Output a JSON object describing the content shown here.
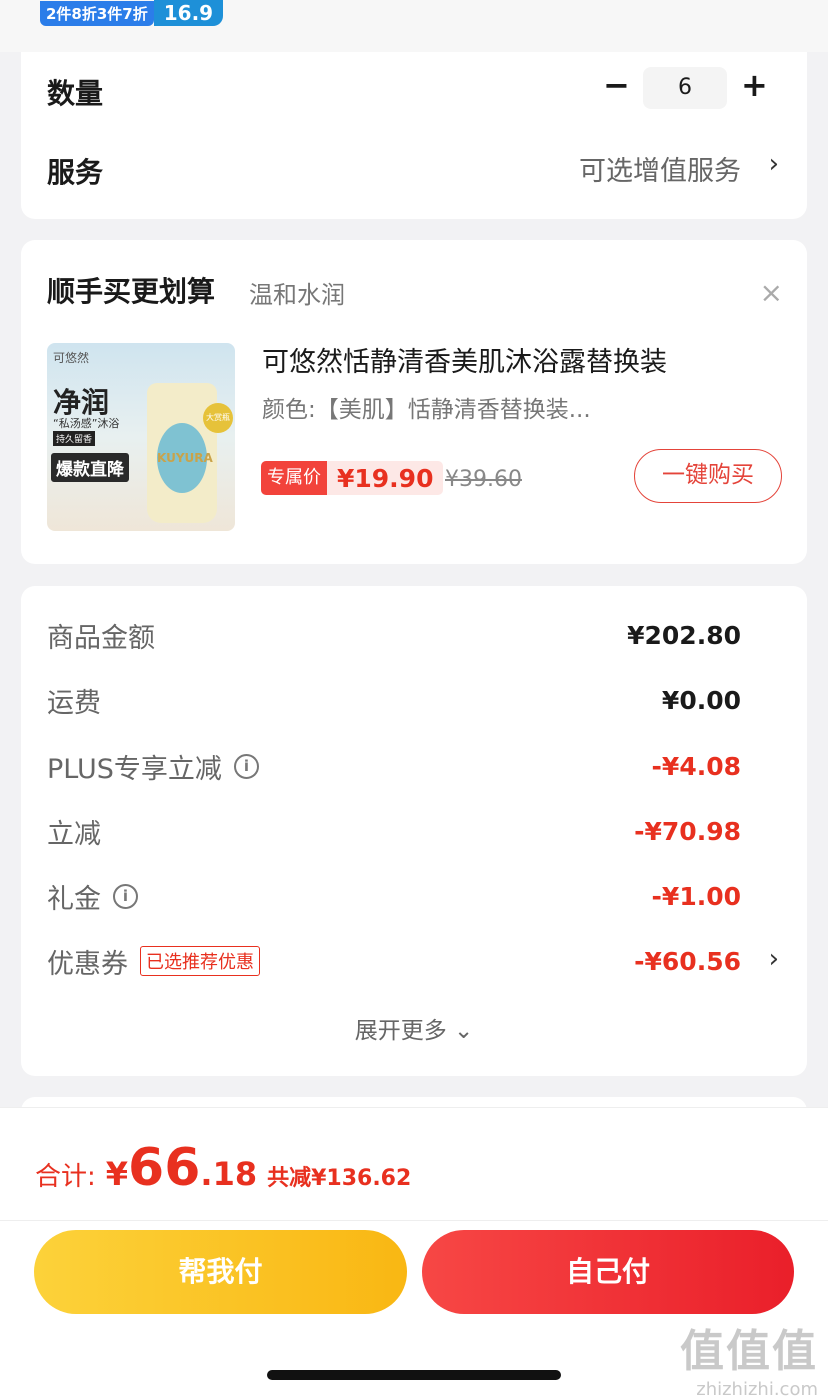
{
  "promo": {
    "text": "2件8折3件7折",
    "badge": "16.9"
  },
  "quantity": {
    "label": "数量",
    "minus": "−",
    "value": "6",
    "plus": "+"
  },
  "service": {
    "label": "服务",
    "value": "可选增值服务",
    "chevron": "›"
  },
  "recommend": {
    "title": "顺手买更划算",
    "subtitle": "温和水润",
    "close": "×",
    "product": {
      "image_brand": "可悠然",
      "image_headline": "净润",
      "image_sub": "“私汤感”沐浴",
      "image_tag": "持久留香",
      "image_hot": "爆款直降",
      "image_label": "KUYURA",
      "image_seal": "大赏瓶",
      "name": "可悠然恬静清香美肌沐浴露替换装",
      "spec": "颜色:【美肌】恬静清香替换装...",
      "price_label": "专属价",
      "price": "¥19.90",
      "original_price": "¥39.60",
      "buy_label": "一键购买"
    }
  },
  "summary": {
    "rows": [
      {
        "label": "商品金额",
        "value": "¥202.80",
        "red": false,
        "info": false
      },
      {
        "label": "运费",
        "value": "¥0.00",
        "red": false,
        "info": false
      },
      {
        "label": "PLUS专享立减",
        "value": "-¥4.08",
        "red": true,
        "info": true
      },
      {
        "label": "立减",
        "value": "-¥70.98",
        "red": true,
        "info": false
      },
      {
        "label": "礼金",
        "value": "-¥1.00",
        "red": true,
        "info": true
      },
      {
        "label": "优惠券",
        "value": "-¥60.56",
        "red": true,
        "info": false,
        "tag": "已选推荐优惠"
      }
    ],
    "info_glyph": "i",
    "chevron": "›",
    "expand_label": "展开更多 ⌄"
  },
  "total": {
    "label": "合计:",
    "currency": "¥",
    "integer": "66",
    "decimal": ".18",
    "saved": "共减¥136.62"
  },
  "actions": {
    "help_pay": "帮我付",
    "self_pay": "自己付"
  },
  "watermark": {
    "big": "值值值",
    "small": "zhizhizhi.com"
  },
  "colors": {
    "accent_red": "#e8301f",
    "button_red": "#f2433b",
    "button_yellow": "#fcd23a"
  }
}
